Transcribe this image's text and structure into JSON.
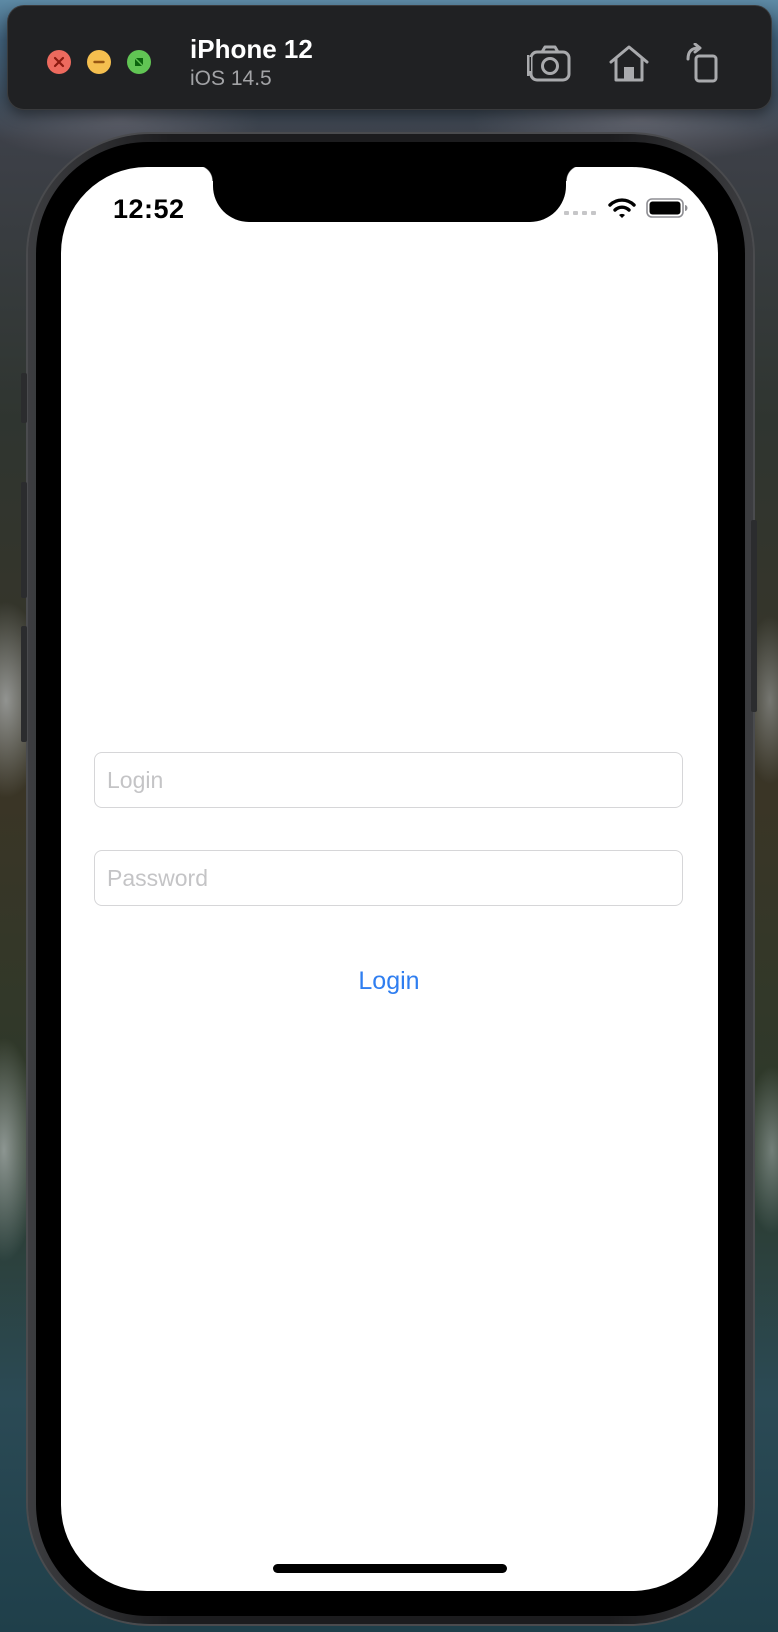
{
  "simulator": {
    "device_name": "iPhone 12",
    "os_version": "iOS 14.5",
    "buttons": {
      "close_icon": "close-icon",
      "minimize_icon": "minimize-icon",
      "zoom_icon": "zoom-icon",
      "screenshot_icon": "camera-icon",
      "home_icon": "home-icon",
      "rotate_icon": "rotate-icon"
    },
    "colors": {
      "close": "#ed6a5e",
      "minimize": "#f5bf4f",
      "zoom": "#61c554",
      "titlebar": "#202123"
    }
  },
  "status_bar": {
    "time": "12:52",
    "icons": [
      "cellular-signal-icon",
      "wifi-icon",
      "battery-icon"
    ]
  },
  "form": {
    "login_placeholder": "Login",
    "login_value": "",
    "password_placeholder": "Password",
    "password_value": "",
    "submit_label": "Login",
    "accent_color": "#2f7ef0"
  }
}
